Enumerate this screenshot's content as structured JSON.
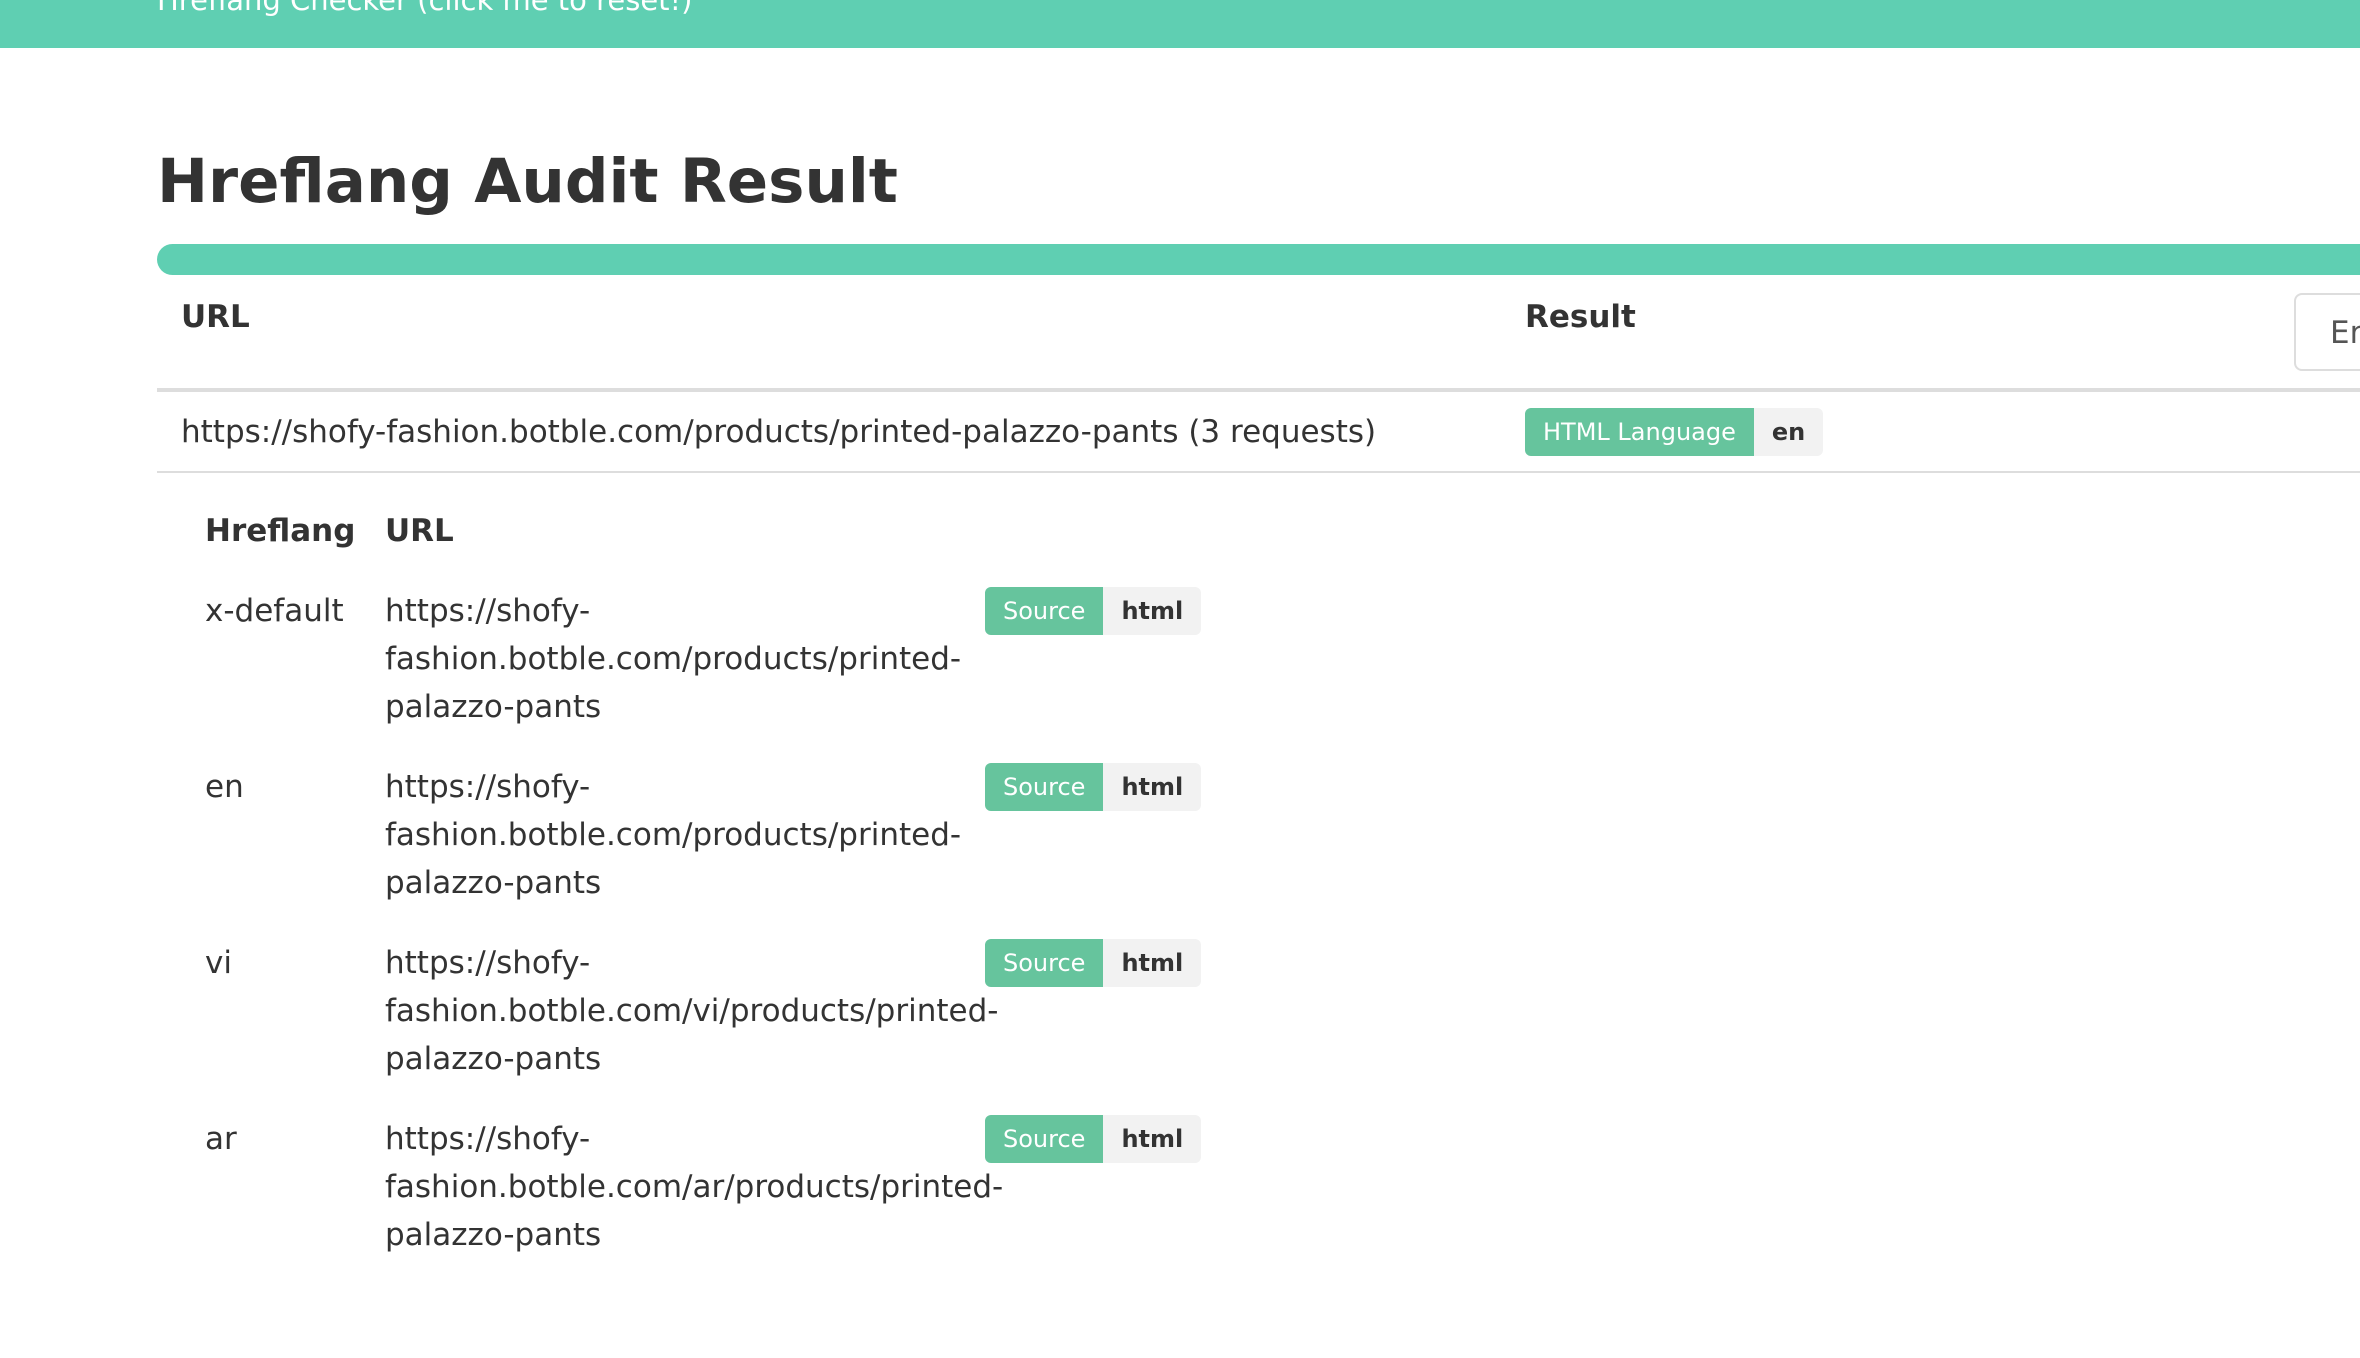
{
  "topbar": {
    "text": "Hreflang Checker (click me to reset!)"
  },
  "page": {
    "title": "Hreflang Audit Result"
  },
  "progress": {
    "value_percent": 100
  },
  "table": {
    "col_url": "URL",
    "col_result": "Result",
    "filter_input_visible_text": "Er"
  },
  "row": {
    "url": "https://shofy-fashion.botble.com/products/printed-palazzo-pants (3 requests)",
    "result_label": "HTML Language",
    "result_value": "en"
  },
  "subtable": {
    "col_hreflang": "Hreflang",
    "col_url": "URL",
    "rows": [
      {
        "hreflang": "x-default",
        "url_lines": [
          "https://shofy-",
          "fashion.botble.com/products/printed-",
          "palazzo-pants"
        ],
        "source_label": "Source",
        "source_value": "html"
      },
      {
        "hreflang": "en",
        "url_lines": [
          "https://shofy-",
          "fashion.botble.com/products/printed-",
          "palazzo-pants"
        ],
        "source_label": "Source",
        "source_value": "html"
      },
      {
        "hreflang": "vi",
        "url_lines": [
          "https://shofy-",
          "fashion.botble.com/vi/products/printed-",
          "palazzo-pants"
        ],
        "source_label": "Source",
        "source_value": "html"
      },
      {
        "hreflang": "ar",
        "url_lines": [
          "https://shofy-",
          "fashion.botble.com/ar/products/printed-",
          "palazzo-pants"
        ],
        "source_label": "Source",
        "source_value": "html"
      }
    ]
  },
  "colors": {
    "accent": "#5fcfb2",
    "badge_green": "#66c49d",
    "badge_gray": "#f2f2f2",
    "text": "#333333"
  }
}
